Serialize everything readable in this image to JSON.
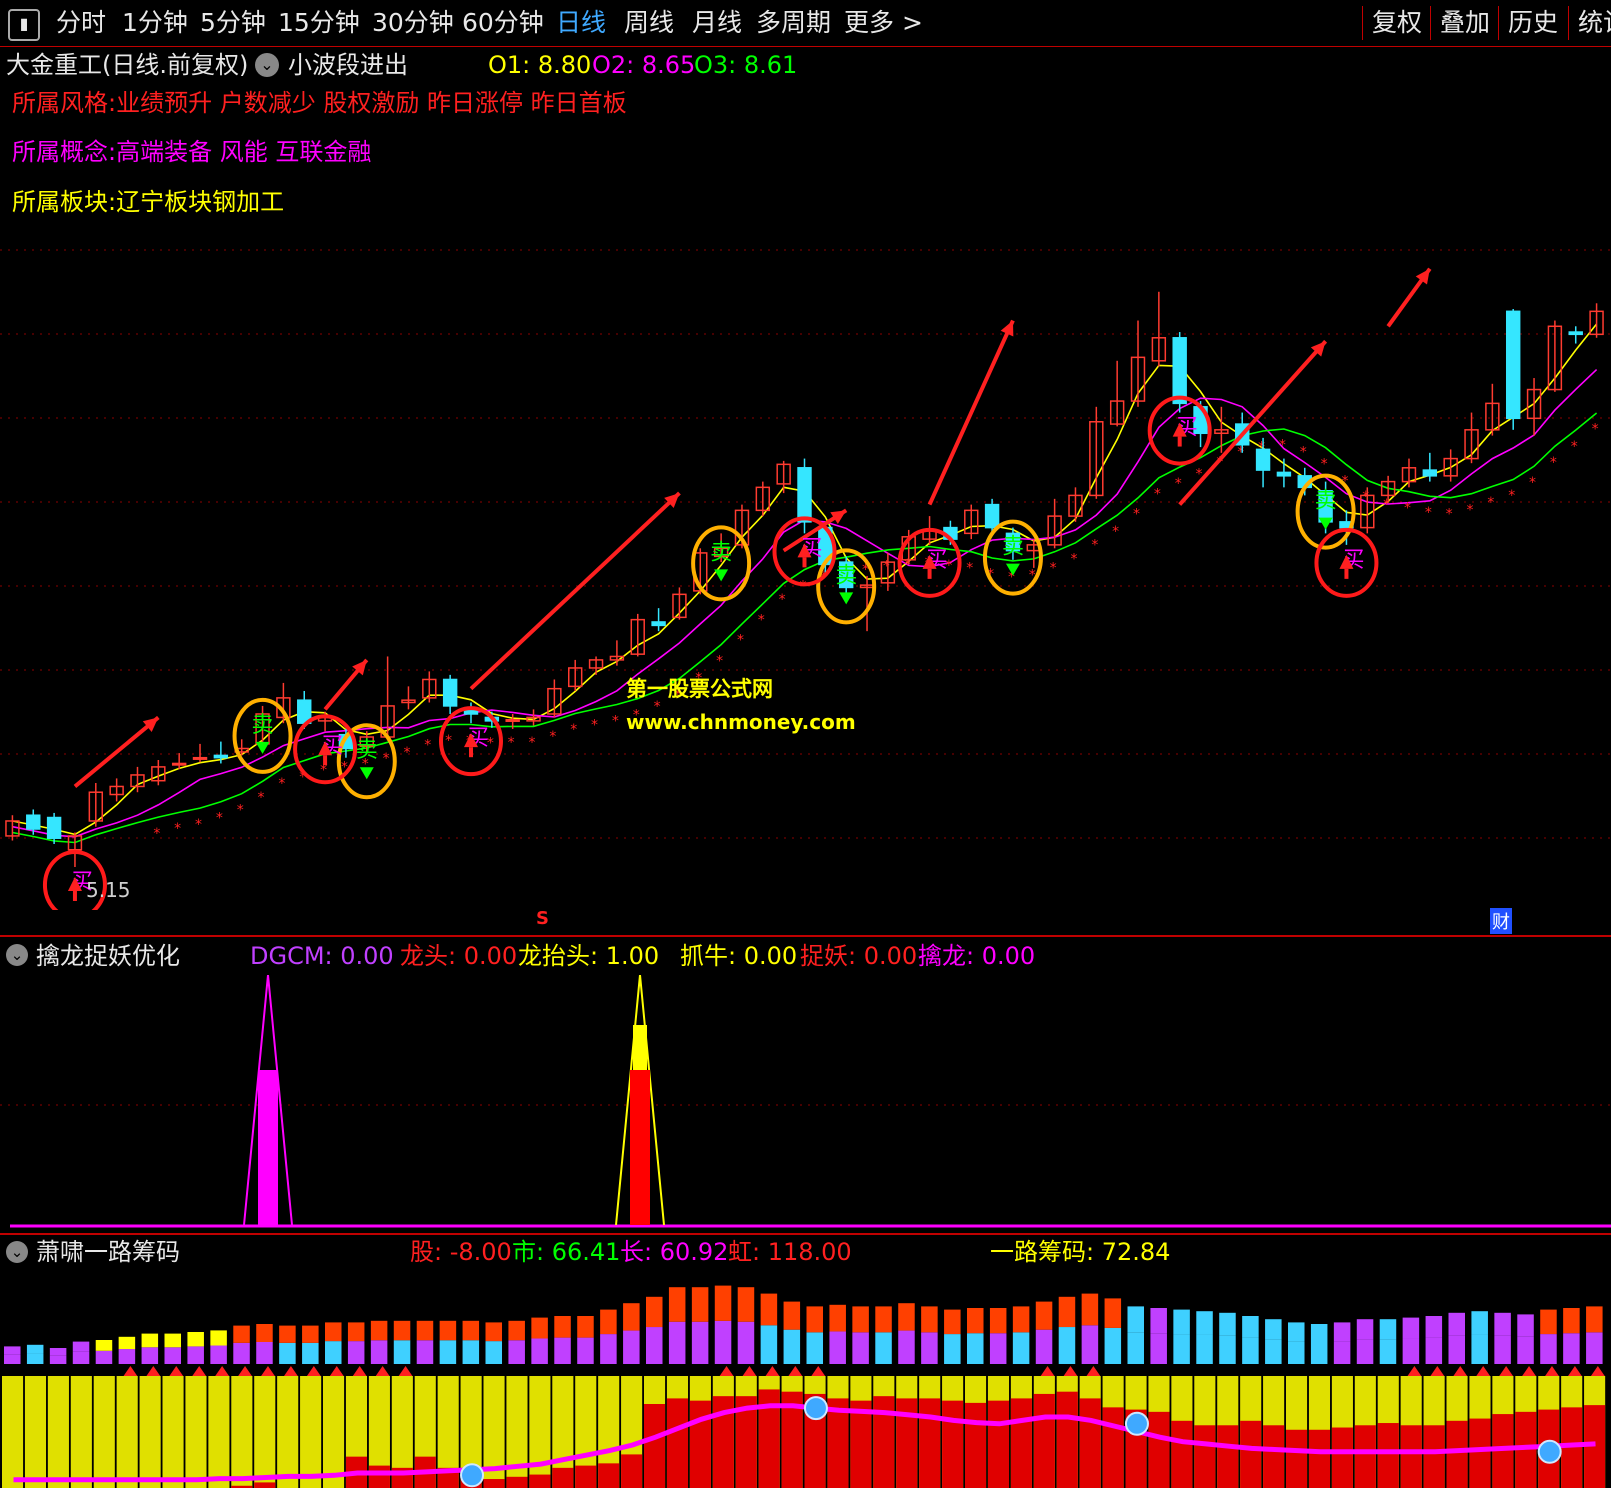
{
  "toolbar": {
    "panel_toggle": "▮",
    "periods": [
      "分时",
      "1分钟",
      "5分钟",
      "15分钟",
      "30分钟",
      "60分钟",
      "日线",
      "周线",
      "月线",
      "多周期",
      "更多 >"
    ],
    "active_period": "日线",
    "right_buttons": [
      "复权",
      "叠加",
      "历史",
      "统计"
    ]
  },
  "main_panel": {
    "title": "大金重工(日线.前复权)",
    "indicator": "小波段进出",
    "o1_label": "O1: 8.80",
    "o2_label": "O2: 8.65",
    "o3_label": "O3: 8.61",
    "style_line": "所属风格:业绩预升 户数减少 股权激励 昨日涨停 昨日首板",
    "concept_line": "所属概念:高端装备 风能 互联金融",
    "sector_line": "所属板块:辽宁板块钢加工",
    "low_price": "5.15",
    "watermark_cn": "第一股票公式网",
    "watermark_url": "www.chnmoney.com",
    "marker_s": "S",
    "marker_cai": "财",
    "buy_label": "买",
    "sell_label": "卖"
  },
  "panel2": {
    "title": "擒龙捉妖优化",
    "dgcm": "DGCM: 0.00",
    "longtou": "龙头: 0.00",
    "longtaitou": "龙抬头: 1.00",
    "zhuaniu": "抓牛: 0.00",
    "zhuoyao": "捉妖: 0.00",
    "qinlong": "擒龙: 0.00"
  },
  "panel3": {
    "title": "萧啸一路筹码",
    "gu": "股: -8.00",
    "shi": "市: 66.41",
    "chang": "长: 60.92",
    "hong": "虹: 118.00",
    "yilu": "一路筹码: 72.84"
  },
  "colors": {
    "up": "#ff3b30",
    "down": "#35e6ff",
    "ma5": "#ffff00",
    "ma10": "#ff00ff",
    "ma20": "#00ff00",
    "grid": "#8b0000",
    "sell_circle": "#ffb000",
    "buy_circle": "#ff1a1a"
  },
  "candles": [
    {
      "o": 5.42,
      "c": 5.55,
      "h": 5.6,
      "l": 5.38
    },
    {
      "o": 5.6,
      "c": 5.48,
      "h": 5.65,
      "l": 5.43
    },
    {
      "o": 5.58,
      "c": 5.4,
      "h": 5.62,
      "l": 5.35
    },
    {
      "o": 5.3,
      "c": 5.42,
      "h": 5.45,
      "l": 5.15
    },
    {
      "o": 5.55,
      "c": 5.8,
      "h": 5.88,
      "l": 5.5
    },
    {
      "o": 5.78,
      "c": 5.85,
      "h": 5.92,
      "l": 5.72
    },
    {
      "o": 5.85,
      "c": 5.95,
      "h": 6.02,
      "l": 5.8
    },
    {
      "o": 5.9,
      "c": 6.02,
      "h": 6.08,
      "l": 5.86
    },
    {
      "o": 6.05,
      "c": 6.05,
      "h": 6.14,
      "l": 6.0
    },
    {
      "o": 6.1,
      "c": 6.1,
      "h": 6.22,
      "l": 6.06
    },
    {
      "o": 6.12,
      "c": 6.1,
      "h": 6.24,
      "l": 6.05
    },
    {
      "o": 6.15,
      "c": 6.18,
      "h": 6.26,
      "l": 6.12
    },
    {
      "o": 6.22,
      "c": 6.48,
      "h": 6.55,
      "l": 6.2
    },
    {
      "o": 6.45,
      "c": 6.62,
      "h": 6.75,
      "l": 6.4
    },
    {
      "o": 6.6,
      "c": 6.4,
      "h": 6.68,
      "l": 6.35
    },
    {
      "o": 6.42,
      "c": 6.45,
      "h": 6.5,
      "l": 6.33
    },
    {
      "o": 6.3,
      "c": 6.18,
      "h": 6.35,
      "l": 6.1
    },
    {
      "o": 6.2,
      "c": 6.28,
      "h": 6.33,
      "l": 6.15
    },
    {
      "o": 6.28,
      "c": 6.55,
      "h": 6.98,
      "l": 6.25
    },
    {
      "o": 6.58,
      "c": 6.6,
      "h": 6.72,
      "l": 6.52
    },
    {
      "o": 6.62,
      "c": 6.78,
      "h": 6.85,
      "l": 6.58
    },
    {
      "o": 6.78,
      "c": 6.55,
      "h": 6.82,
      "l": 6.48
    },
    {
      "o": 6.52,
      "c": 6.48,
      "h": 6.58,
      "l": 6.4
    },
    {
      "o": 6.45,
      "c": 6.42,
      "h": 6.5,
      "l": 6.36
    },
    {
      "o": 6.43,
      "c": 6.43,
      "h": 6.48,
      "l": 6.35
    },
    {
      "o": 6.42,
      "c": 6.45,
      "h": 6.52,
      "l": 6.38
    },
    {
      "o": 6.48,
      "c": 6.7,
      "h": 6.78,
      "l": 6.45
    },
    {
      "o": 6.72,
      "c": 6.88,
      "h": 6.95,
      "l": 6.68
    },
    {
      "o": 6.88,
      "c": 6.95,
      "h": 6.98,
      "l": 6.82
    },
    {
      "o": 6.95,
      "c": 6.98,
      "h": 7.12,
      "l": 6.9
    },
    {
      "o": 7.0,
      "c": 7.3,
      "h": 7.35,
      "l": 6.98
    },
    {
      "o": 7.28,
      "c": 7.25,
      "h": 7.4,
      "l": 7.2
    },
    {
      "o": 7.32,
      "c": 7.52,
      "h": 7.58,
      "l": 7.3
    },
    {
      "o": 7.55,
      "c": 7.88,
      "h": 7.92,
      "l": 7.52
    },
    {
      "o": 7.85,
      "c": 7.92,
      "h": 8.05,
      "l": 7.8
    },
    {
      "o": 7.95,
      "c": 8.25,
      "h": 8.3,
      "l": 7.92
    },
    {
      "o": 8.25,
      "c": 8.45,
      "h": 8.5,
      "l": 8.2
    },
    {
      "o": 8.48,
      "c": 8.65,
      "h": 8.68,
      "l": 8.4
    },
    {
      "o": 8.62,
      "c": 8.15,
      "h": 8.7,
      "l": 8.05
    },
    {
      "o": 8.1,
      "c": 7.78,
      "h": 8.15,
      "l": 7.7
    },
    {
      "o": 7.8,
      "c": 7.58,
      "h": 7.85,
      "l": 7.5
    },
    {
      "o": 7.58,
      "c": 7.6,
      "h": 7.68,
      "l": 7.2
    },
    {
      "o": 7.62,
      "c": 7.8,
      "h": 7.88,
      "l": 7.55
    },
    {
      "o": 7.82,
      "c": 8.02,
      "h": 8.08,
      "l": 7.78
    },
    {
      "o": 8.0,
      "c": 8.08,
      "h": 8.2,
      "l": 7.95
    },
    {
      "o": 8.1,
      "c": 8.0,
      "h": 8.16,
      "l": 7.95
    },
    {
      "o": 8.05,
      "c": 8.25,
      "h": 8.3,
      "l": 8.0
    },
    {
      "o": 8.3,
      "c": 8.1,
      "h": 8.35,
      "l": 8.05
    },
    {
      "o": 8.05,
      "c": 7.9,
      "h": 8.1,
      "l": 7.82
    },
    {
      "o": 7.9,
      "c": 7.95,
      "h": 8.0,
      "l": 7.75
    },
    {
      "o": 7.95,
      "c": 8.2,
      "h": 8.35,
      "l": 7.92
    },
    {
      "o": 8.2,
      "c": 8.38,
      "h": 8.45,
      "l": 8.15
    },
    {
      "o": 8.38,
      "c": 9.02,
      "h": 9.15,
      "l": 8.35
    },
    {
      "o": 9.0,
      "c": 9.2,
      "h": 9.55,
      "l": 8.98
    },
    {
      "o": 9.2,
      "c": 9.58,
      "h": 9.9,
      "l": 9.15
    },
    {
      "o": 9.55,
      "c": 9.75,
      "h": 10.15,
      "l": 9.5
    },
    {
      "o": 9.75,
      "c": 9.18,
      "h": 9.8,
      "l": 9.1
    },
    {
      "o": 9.15,
      "c": 8.92,
      "h": 9.2,
      "l": 8.8
    },
    {
      "o": 8.92,
      "c": 8.95,
      "h": 9.15,
      "l": 8.75
    },
    {
      "o": 9.0,
      "c": 8.82,
      "h": 9.1,
      "l": 8.75
    },
    {
      "o": 8.78,
      "c": 8.6,
      "h": 8.88,
      "l": 8.45
    },
    {
      "o": 8.58,
      "c": 8.55,
      "h": 8.7,
      "l": 8.45
    },
    {
      "o": 8.55,
      "c": 8.45,
      "h": 8.62,
      "l": 8.38
    },
    {
      "o": 8.42,
      "c": 8.15,
      "h": 8.5,
      "l": 8.05
    },
    {
      "o": 8.15,
      "c": 8.1,
      "h": 8.25,
      "l": 7.95
    },
    {
      "o": 8.1,
      "c": 8.38,
      "h": 8.45,
      "l": 8.05
    },
    {
      "o": 8.38,
      "c": 8.5,
      "h": 8.55,
      "l": 8.32
    },
    {
      "o": 8.5,
      "c": 8.62,
      "h": 8.7,
      "l": 8.45
    },
    {
      "o": 8.6,
      "c": 8.55,
      "h": 8.75,
      "l": 8.5
    },
    {
      "o": 8.55,
      "c": 8.7,
      "h": 8.78,
      "l": 8.5
    },
    {
      "o": 8.7,
      "c": 8.95,
      "h": 9.1,
      "l": 8.66
    },
    {
      "o": 8.95,
      "c": 9.18,
      "h": 9.35,
      "l": 8.9
    },
    {
      "o": 9.98,
      "c": 9.05,
      "h": 10.0,
      "l": 8.95
    },
    {
      "o": 9.05,
      "c": 9.3,
      "h": 9.4,
      "l": 8.9
    },
    {
      "o": 9.3,
      "c": 9.85,
      "h": 9.9,
      "l": 9.28
    },
    {
      "o": 9.8,
      "c": 9.78,
      "h": 9.85,
      "l": 9.7
    },
    {
      "o": 9.78,
      "c": 9.98,
      "h": 10.05,
      "l": 9.75
    }
  ],
  "sell_signals": [
    12,
    17,
    34,
    40,
    48,
    63
  ],
  "buy_signals": [
    3,
    15,
    22,
    38,
    44,
    56,
    64
  ],
  "trend_arrows": [
    [
      3,
      7,
      5.85,
      6.45
    ],
    [
      15,
      17,
      6.52,
      6.95
    ],
    [
      22,
      32,
      6.7,
      8.4
    ],
    [
      37,
      40,
      7.9,
      8.25
    ],
    [
      44,
      48,
      8.3,
      9.9
    ],
    [
      56,
      63,
      8.3,
      9.72
    ],
    [
      66,
      68,
      9.85,
      10.35
    ]
  ],
  "dgcm_spikes": [
    {
      "bar": 11,
      "color": "#ff00ff",
      "height": 1.0,
      "fill": 0.62
    },
    {
      "bar": 27,
      "color": "#ffff00",
      "height": 1.0,
      "fill": 0.62
    }
  ],
  "chip_bars": [
    {
      "bottom": "#c040ff",
      "top": "#c040ff",
      "val": 0.22
    },
    {
      "bottom": "#3fd0ff",
      "top": "#3fd0ff",
      "val": 0.24
    },
    {
      "bottom": "#c040ff",
      "top": "#c040ff",
      "val": 0.2
    },
    {
      "bottom": "#c040ff",
      "top": "#c040ff",
      "val": 0.28
    },
    {
      "bottom": "#c040ff",
      "top": "#ffff00",
      "val": 0.3
    },
    {
      "bottom": "#c040ff",
      "top": "#ffff00",
      "val": 0.34
    },
    {
      "bottom": "#c040ff",
      "top": "#ffff00",
      "val": 0.38
    },
    {
      "bottom": "#c040ff",
      "top": "#ffff00",
      "val": 0.38
    },
    {
      "bottom": "#c040ff",
      "top": "#ffff00",
      "val": 0.4
    },
    {
      "bottom": "#c040ff",
      "top": "#ffff00",
      "val": 0.42
    },
    {
      "bottom": "#c040ff",
      "top": "#ff4000",
      "val": 0.48
    },
    {
      "bottom": "#c040ff",
      "top": "#ff4000",
      "val": 0.5
    },
    {
      "bottom": "#3fd0ff",
      "top": "#ff4000",
      "val": 0.48
    },
    {
      "bottom": "#3fd0ff",
      "top": "#ff4000",
      "val": 0.48
    },
    {
      "bottom": "#3fd0ff",
      "top": "#ff4000",
      "val": 0.52
    },
    {
      "bottom": "#c040ff",
      "top": "#ff4000",
      "val": 0.52
    },
    {
      "bottom": "#c040ff",
      "top": "#ff4000",
      "val": 0.54
    },
    {
      "bottom": "#3fd0ff",
      "top": "#ff4000",
      "val": 0.54
    },
    {
      "bottom": "#c040ff",
      "top": "#ff4000",
      "val": 0.54
    },
    {
      "bottom": "#3fd0ff",
      "top": "#ff4000",
      "val": 0.54
    },
    {
      "bottom": "#3fd0ff",
      "top": "#ff4000",
      "val": 0.54
    },
    {
      "bottom": "#3fd0ff",
      "top": "#ff4000",
      "val": 0.52
    },
    {
      "bottom": "#c040ff",
      "top": "#ff4000",
      "val": 0.54
    },
    {
      "bottom": "#c040ff",
      "top": "#ff4000",
      "val": 0.58
    },
    {
      "bottom": "#c040ff",
      "top": "#ff4000",
      "val": 0.6
    },
    {
      "bottom": "#c040ff",
      "top": "#ff4000",
      "val": 0.6
    },
    {
      "bottom": "#c040ff",
      "top": "#ff4000",
      "val": 0.68
    },
    {
      "bottom": "#c040ff",
      "top": "#ff4000",
      "val": 0.76
    },
    {
      "bottom": "#c040ff",
      "top": "#ff4000",
      "val": 0.84
    },
    {
      "bottom": "#c040ff",
      "top": "#ff4000",
      "val": 0.96
    },
    {
      "bottom": "#c040ff",
      "top": "#ff4000",
      "val": 0.96
    },
    {
      "bottom": "#c040ff",
      "top": "#ff4000",
      "val": 0.98
    },
    {
      "bottom": "#c040ff",
      "top": "#ff4000",
      "val": 0.96
    },
    {
      "bottom": "#3fd0ff",
      "top": "#ff4000",
      "val": 0.88
    },
    {
      "bottom": "#3fd0ff",
      "top": "#ff4000",
      "val": 0.78
    },
    {
      "bottom": "#3fd0ff",
      "top": "#ff4000",
      "val": 0.72
    },
    {
      "bottom": "#c040ff",
      "top": "#ff4000",
      "val": 0.74
    },
    {
      "bottom": "#c040ff",
      "top": "#ff4000",
      "val": 0.72
    },
    {
      "bottom": "#3fd0ff",
      "top": "#ff4000",
      "val": 0.72
    },
    {
      "bottom": "#c040ff",
      "top": "#ff4000",
      "val": 0.76
    },
    {
      "bottom": "#c040ff",
      "top": "#ff4000",
      "val": 0.72
    },
    {
      "bottom": "#3fd0ff",
      "top": "#ff4000",
      "val": 0.68
    },
    {
      "bottom": "#3fd0ff",
      "top": "#ff4000",
      "val": 0.7
    },
    {
      "bottom": "#c040ff",
      "top": "#ff4000",
      "val": 0.7
    },
    {
      "bottom": "#3fd0ff",
      "top": "#ff4000",
      "val": 0.72
    },
    {
      "bottom": "#c040ff",
      "top": "#ff4000",
      "val": 0.78
    },
    {
      "bottom": "#3fd0ff",
      "top": "#ff4000",
      "val": 0.84
    },
    {
      "bottom": "#c040ff",
      "top": "#ff4000",
      "val": 0.88
    },
    {
      "bottom": "#3fd0ff",
      "top": "#ff4000",
      "val": 0.82
    },
    {
      "bottom": "#3fd0ff",
      "top": "#3fd0ff",
      "val": 0.72
    },
    {
      "bottom": "#c040ff",
      "top": "#c040ff",
      "val": 0.7
    },
    {
      "bottom": "#3fd0ff",
      "top": "#3fd0ff",
      "val": 0.68
    },
    {
      "bottom": "#3fd0ff",
      "top": "#3fd0ff",
      "val": 0.66
    },
    {
      "bottom": "#3fd0ff",
      "top": "#3fd0ff",
      "val": 0.64
    },
    {
      "bottom": "#3fd0ff",
      "top": "#3fd0ff",
      "val": 0.6
    },
    {
      "bottom": "#3fd0ff",
      "top": "#3fd0ff",
      "val": 0.56
    },
    {
      "bottom": "#3fd0ff",
      "top": "#3fd0ff",
      "val": 0.52
    },
    {
      "bottom": "#3fd0ff",
      "top": "#3fd0ff",
      "val": 0.5
    },
    {
      "bottom": "#c040ff",
      "top": "#c040ff",
      "val": 0.52
    },
    {
      "bottom": "#c040ff",
      "top": "#c040ff",
      "val": 0.56
    },
    {
      "bottom": "#3fd0ff",
      "top": "#3fd0ff",
      "val": 0.56
    },
    {
      "bottom": "#c040ff",
      "top": "#c040ff",
      "val": 0.58
    },
    {
      "bottom": "#c040ff",
      "top": "#c040ff",
      "val": 0.6
    },
    {
      "bottom": "#c040ff",
      "top": "#c040ff",
      "val": 0.64
    },
    {
      "bottom": "#3fd0ff",
      "top": "#3fd0ff",
      "val": 0.66
    },
    {
      "bottom": "#c040ff",
      "top": "#c040ff",
      "val": 0.64
    },
    {
      "bottom": "#c040ff",
      "top": "#c040ff",
      "val": 0.62
    },
    {
      "bottom": "#c040ff",
      "top": "#ff4000",
      "val": 0.68
    },
    {
      "bottom": "#c040ff",
      "top": "#ff4000",
      "val": 0.7
    },
    {
      "bottom": "#c040ff",
      "top": "#ff4000",
      "val": 0.72
    }
  ],
  "volume_levels": [
    0.0,
    0.0,
    0.0,
    0.0,
    0.0,
    0.0,
    0.0,
    0.0,
    0.0,
    0.0,
    0.02,
    0.05,
    0.0,
    0.0,
    0.0,
    0.28,
    0.2,
    0.18,
    0.28,
    0.18,
    0.14,
    0.08,
    0.1,
    0.12,
    0.18,
    0.2,
    0.22,
    0.3,
    0.75,
    0.8,
    0.78,
    0.82,
    0.82,
    0.88,
    0.86,
    0.84,
    0.8,
    0.78,
    0.82,
    0.8,
    0.8,
    0.78,
    0.76,
    0.78,
    0.8,
    0.84,
    0.86,
    0.8,
    0.72,
    0.7,
    0.68,
    0.6,
    0.56,
    0.56,
    0.6,
    0.56,
    0.52,
    0.52,
    0.54,
    0.56,
    0.58,
    0.56,
    0.56,
    0.6,
    0.62,
    0.66,
    0.68,
    0.7,
    0.72,
    0.74
  ],
  "chip_line": [
    0.02,
    0.02,
    0.02,
    0.02,
    0.02,
    0.02,
    0.02,
    0.02,
    0.02,
    0.03,
    0.03,
    0.04,
    0.05,
    0.05,
    0.06,
    0.08,
    0.08,
    0.08,
    0.09,
    0.1,
    0.11,
    0.12,
    0.14,
    0.16,
    0.2,
    0.24,
    0.28,
    0.33,
    0.4,
    0.48,
    0.56,
    0.62,
    0.66,
    0.68,
    0.68,
    0.66,
    0.64,
    0.63,
    0.62,
    0.6,
    0.58,
    0.55,
    0.53,
    0.52,
    0.55,
    0.58,
    0.58,
    0.55,
    0.5,
    0.45,
    0.4,
    0.36,
    0.34,
    0.32,
    0.3,
    0.29,
    0.28,
    0.27,
    0.27,
    0.27,
    0.27,
    0.27,
    0.27,
    0.28,
    0.29,
    0.3,
    0.31,
    0.32,
    0.33,
    0.34
  ]
}
